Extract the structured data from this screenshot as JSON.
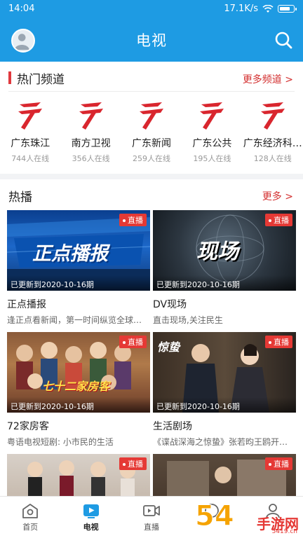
{
  "status": {
    "time": "14:04",
    "speed": "17.1K/s",
    "battery_level": 0.85
  },
  "appbar": {
    "title": "电视"
  },
  "hot_channels": {
    "title": "热门频道",
    "more": "更多频道 >",
    "items": [
      {
        "name": "广东珠江",
        "count": "744人在线"
      },
      {
        "name": "南方卫视",
        "count": "356人在线"
      },
      {
        "name": "广东新闻",
        "count": "259人在线"
      },
      {
        "name": "广东公共",
        "count": "195人在线"
      },
      {
        "name": "广东经济科…",
        "count": "128人在线"
      }
    ]
  },
  "hot_shows": {
    "title": "热播",
    "more": "更多 >",
    "cards": [
      {
        "tag": "直播",
        "updated": "已更新到2020-10-16期",
        "title": "正点播报",
        "desc": "逢正点看新闻，第一时间纵览全球…",
        "overlay": "正点播报"
      },
      {
        "tag": "直播",
        "updated": "已更新到2020-10-16期",
        "title": "DV现场",
        "desc": "直击现场,关注民生",
        "overlay": "现场"
      },
      {
        "tag": "直播",
        "updated": "已更新到2020-10-16期",
        "title": "72家房客",
        "desc": "粤语电视短剧: 小市民的生活",
        "overlay": "七十二家房客"
      },
      {
        "tag": "直播",
        "updated": "已更新到2020-10-16期",
        "title": "生活剧场",
        "desc": "《谍战深海之惊蛰》张若昀王鸥开…",
        "overlay": "惊蛰"
      },
      {
        "tag": "直播"
      },
      {
        "tag": "直播"
      }
    ]
  },
  "tabs": [
    {
      "label": "首页",
      "icon": "home-icon"
    },
    {
      "label": "电视",
      "icon": "tv-play-icon",
      "active": true
    },
    {
      "label": "直播",
      "icon": "video-camera-icon"
    },
    {
      "label": "",
      "icon": "circle-icon"
    },
    {
      "label": "",
      "icon": "user-icon"
    }
  ],
  "watermark": {
    "num": "54",
    "text": "手游网",
    "url": "5419.cn"
  },
  "colors": {
    "brand_blue": "#1e9be3",
    "accent_red": "#e53935"
  }
}
